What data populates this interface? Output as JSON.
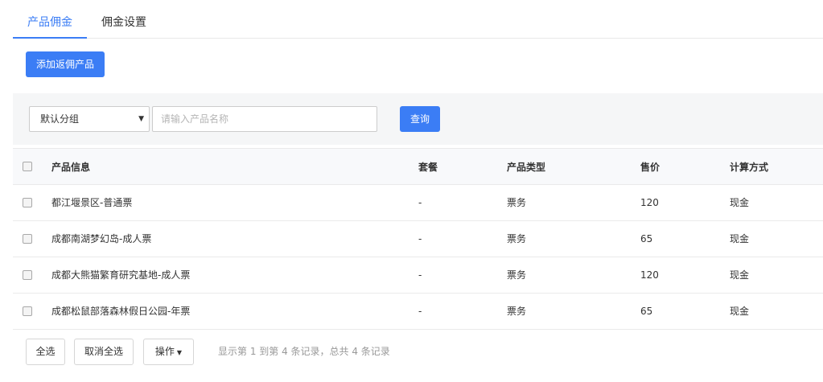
{
  "tabs": [
    {
      "label": "产品佣金",
      "active": true
    },
    {
      "label": "佣金设置",
      "active": false
    }
  ],
  "toolbar": {
    "add_label": "添加返佣产品"
  },
  "filter": {
    "group_value": "默认分组",
    "search_placeholder": "请输入产品名称",
    "query_label": "查询"
  },
  "table": {
    "headers": {
      "name": "产品信息",
      "package": "套餐",
      "type": "产品类型",
      "price": "售价",
      "calc": "计算方式"
    },
    "rows": [
      {
        "name": "都江堰景区-普通票",
        "package": "-",
        "type": "票务",
        "price": "120",
        "calc": "现金"
      },
      {
        "name": "成都南湖梦幻岛-成人票",
        "package": "-",
        "type": "票务",
        "price": "65",
        "calc": "现金"
      },
      {
        "name": "成都大熊猫繁育研究基地-成人票",
        "package": "-",
        "type": "票务",
        "price": "120",
        "calc": "现金"
      },
      {
        "name": "成都松鼠部落森林假日公园-年票",
        "package": "-",
        "type": "票务",
        "price": "65",
        "calc": "现金"
      }
    ]
  },
  "footer": {
    "select_all_label": "全选",
    "deselect_all_label": "取消全选",
    "actions_label": "操作",
    "record_info": "显示第 1 到第 4 条记录，总共 4 条记录"
  },
  "colors": {
    "accent": "#3b7df5",
    "filter_bg": "#f5f6f7",
    "header_bg": "#f8f9fb"
  }
}
